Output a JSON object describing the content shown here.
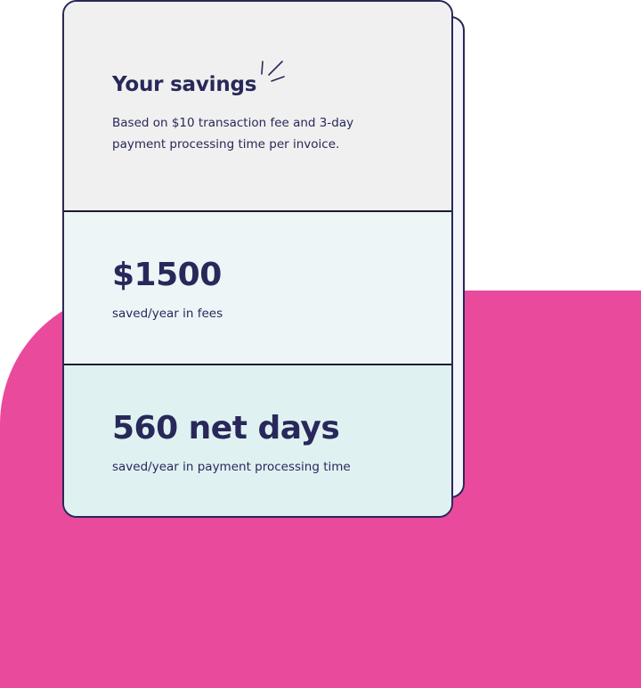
{
  "savings": {
    "title": "Your savings",
    "description": "Based on $10 transaction fee and 3-day payment processing time per invoice."
  },
  "fees": {
    "value": "$1500",
    "label": "saved/year in fees"
  },
  "days": {
    "value": "560 net days",
    "label": "saved/year in payment processing time"
  },
  "colors": {
    "navy": "#28285a",
    "pink": "#e94a9c",
    "card_top": "#f0f0f0",
    "card_mid": "#edf5f7",
    "card_bot": "#e0f1f2"
  },
  "icons": {
    "title_accent": "sparkle-icon"
  }
}
